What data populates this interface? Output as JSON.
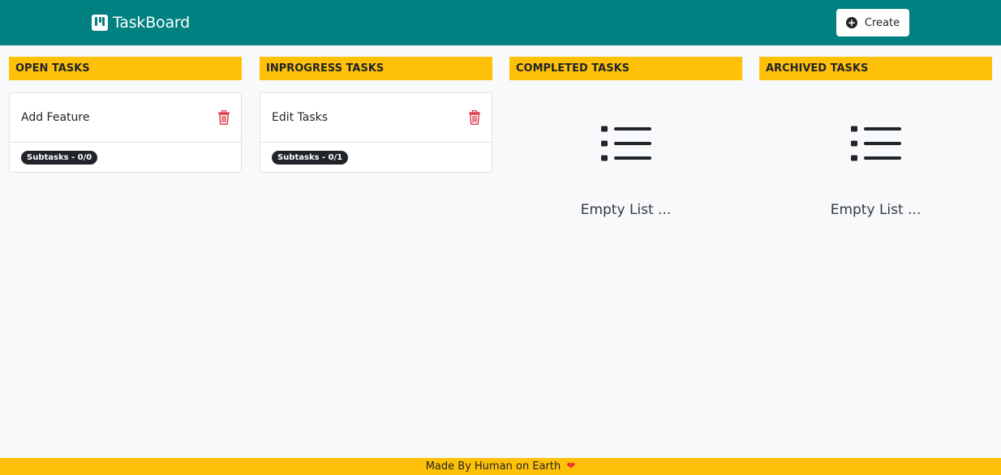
{
  "header": {
    "brand": {
      "icon": "kanban-board-icon",
      "title": "TaskBoard"
    },
    "create_button": {
      "icon": "plus-circle-icon",
      "label": "Create"
    }
  },
  "columns": [
    {
      "title": "OPEN TASKS",
      "tasks": [
        {
          "title": "Add Feature",
          "subtasks": "Subtasks - 0/0",
          "delete_icon": "trash-icon"
        }
      ]
    },
    {
      "title": "INPROGRESS TASKS",
      "tasks": [
        {
          "title": "Edit Tasks",
          "subtasks": "Subtasks - 0/1",
          "delete_icon": "trash-icon"
        }
      ]
    },
    {
      "title": "COMPLETED TASKS",
      "tasks": [],
      "empty": {
        "icon": "list-icon",
        "text": "Empty List ..."
      }
    },
    {
      "title": "ARCHIVED TASKS",
      "tasks": [],
      "empty": {
        "icon": "list-icon",
        "text": "Empty List ..."
      }
    }
  ],
  "footer": {
    "text": "Made By Human on Earth",
    "icon": "heart-icon"
  },
  "colors": {
    "navbar": "#008080",
    "column_header": "#ffc107",
    "delete": "#dc3545",
    "badge": "#212529",
    "footer": "#ffc107"
  }
}
